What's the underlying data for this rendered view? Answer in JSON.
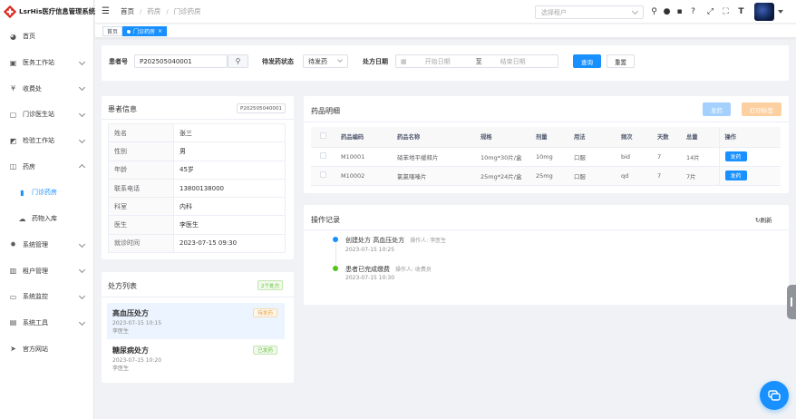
{
  "app": {
    "title": "LsrHis医疗信息管理系统"
  },
  "sidebar": {
    "items": [
      {
        "label": "首页",
        "icon": "dashboard-icon"
      },
      {
        "label": "医务工作站",
        "icon": "medical-icon"
      },
      {
        "label": "收费处",
        "icon": "yen-icon"
      },
      {
        "label": "门诊医生站",
        "icon": "doctor-icon"
      },
      {
        "label": "检验工作站",
        "icon": "lab-icon"
      },
      {
        "label": "药房",
        "icon": "pharmacy-icon"
      },
      {
        "label": "门诊药房",
        "icon": "outpatient-pharmacy-icon"
      },
      {
        "label": "药物入库",
        "icon": "cloud-icon"
      },
      {
        "label": "系统管理",
        "icon": "gear-icon"
      },
      {
        "label": "租户管理",
        "icon": "chart-icon"
      },
      {
        "label": "系统监控",
        "icon": "monitor-icon"
      },
      {
        "label": "系统工具",
        "icon": "tool-icon"
      },
      {
        "label": "官方网站",
        "icon": "send-icon"
      }
    ]
  },
  "header": {
    "breadcrumb": [
      "首页",
      "药房",
      "门诊药房"
    ],
    "tenant_placeholder": "选择租户"
  },
  "tabs": [
    {
      "label": "首页"
    },
    {
      "label": "门诊药房",
      "close": "×"
    }
  ],
  "search": {
    "patient_label": "患者号",
    "patient_value": "P202505040001",
    "status_label": "待发药状态",
    "status_value": "待发药",
    "date_label": "处方日期",
    "date_start_placeholder": "开始日期",
    "date_to": "至",
    "date_end_placeholder": "结束日期",
    "query_label": "查询",
    "reset_label": "重置"
  },
  "patient": {
    "title": "患者信息",
    "id_badge": "P202505040001",
    "rows": [
      {
        "k": "姓名",
        "v": "张三"
      },
      {
        "k": "性别",
        "v": "男"
      },
      {
        "k": "年龄",
        "v": "45岁"
      },
      {
        "k": "联系电话",
        "v": "13800138000"
      },
      {
        "k": "科室",
        "v": "内科"
      },
      {
        "k": "医生",
        "v": "李医生"
      },
      {
        "k": "就诊时间",
        "v": "2023-07-15 09:30"
      }
    ]
  },
  "prescriptions": {
    "title": "处方列表",
    "count_badge": "2个处方",
    "items": [
      {
        "name": "高血压处方",
        "time": "2023-07-15 10:15",
        "doctor": "李医生",
        "status": "待发药"
      },
      {
        "name": "糖尿病处方",
        "time": "2023-07-15 10:20",
        "doctor": "李医生",
        "status": "已发药"
      }
    ]
  },
  "drugs": {
    "title": "药品明细",
    "dispense_label": "发药",
    "print_label": "打印标签",
    "columns": [
      "药品编码",
      "药品名称",
      "规格",
      "剂量",
      "用法",
      "频次",
      "天数",
      "总量",
      "操作"
    ],
    "rows": [
      [
        "M10001",
        "硝苯地平缓释片",
        "10mg*30片/盒",
        "10mg",
        "口服",
        "bid",
        "7",
        "14片",
        "发药"
      ],
      [
        "M10002",
        "氯氯噻嗪片",
        "25mg*24片/盒",
        "25mg",
        "口服",
        "qd",
        "7",
        "7片",
        "发药"
      ]
    ]
  },
  "log": {
    "title": "操作记录",
    "refresh_label": "刷新",
    "entries": [
      {
        "text": "创建处方 高血压处方",
        "operator": "操作人: 李医生",
        "time": "2023-07-15 10:25",
        "color": "#1890ff"
      },
      {
        "text": "患者已完成缴费",
        "operator": "操作人: 收费员",
        "time": "2023-07-15 10:30",
        "color": "#52c41a"
      }
    ]
  },
  "colors": {
    "primary": "#1890ff",
    "success": "#52c41a",
    "warning": "#fa8c16"
  }
}
